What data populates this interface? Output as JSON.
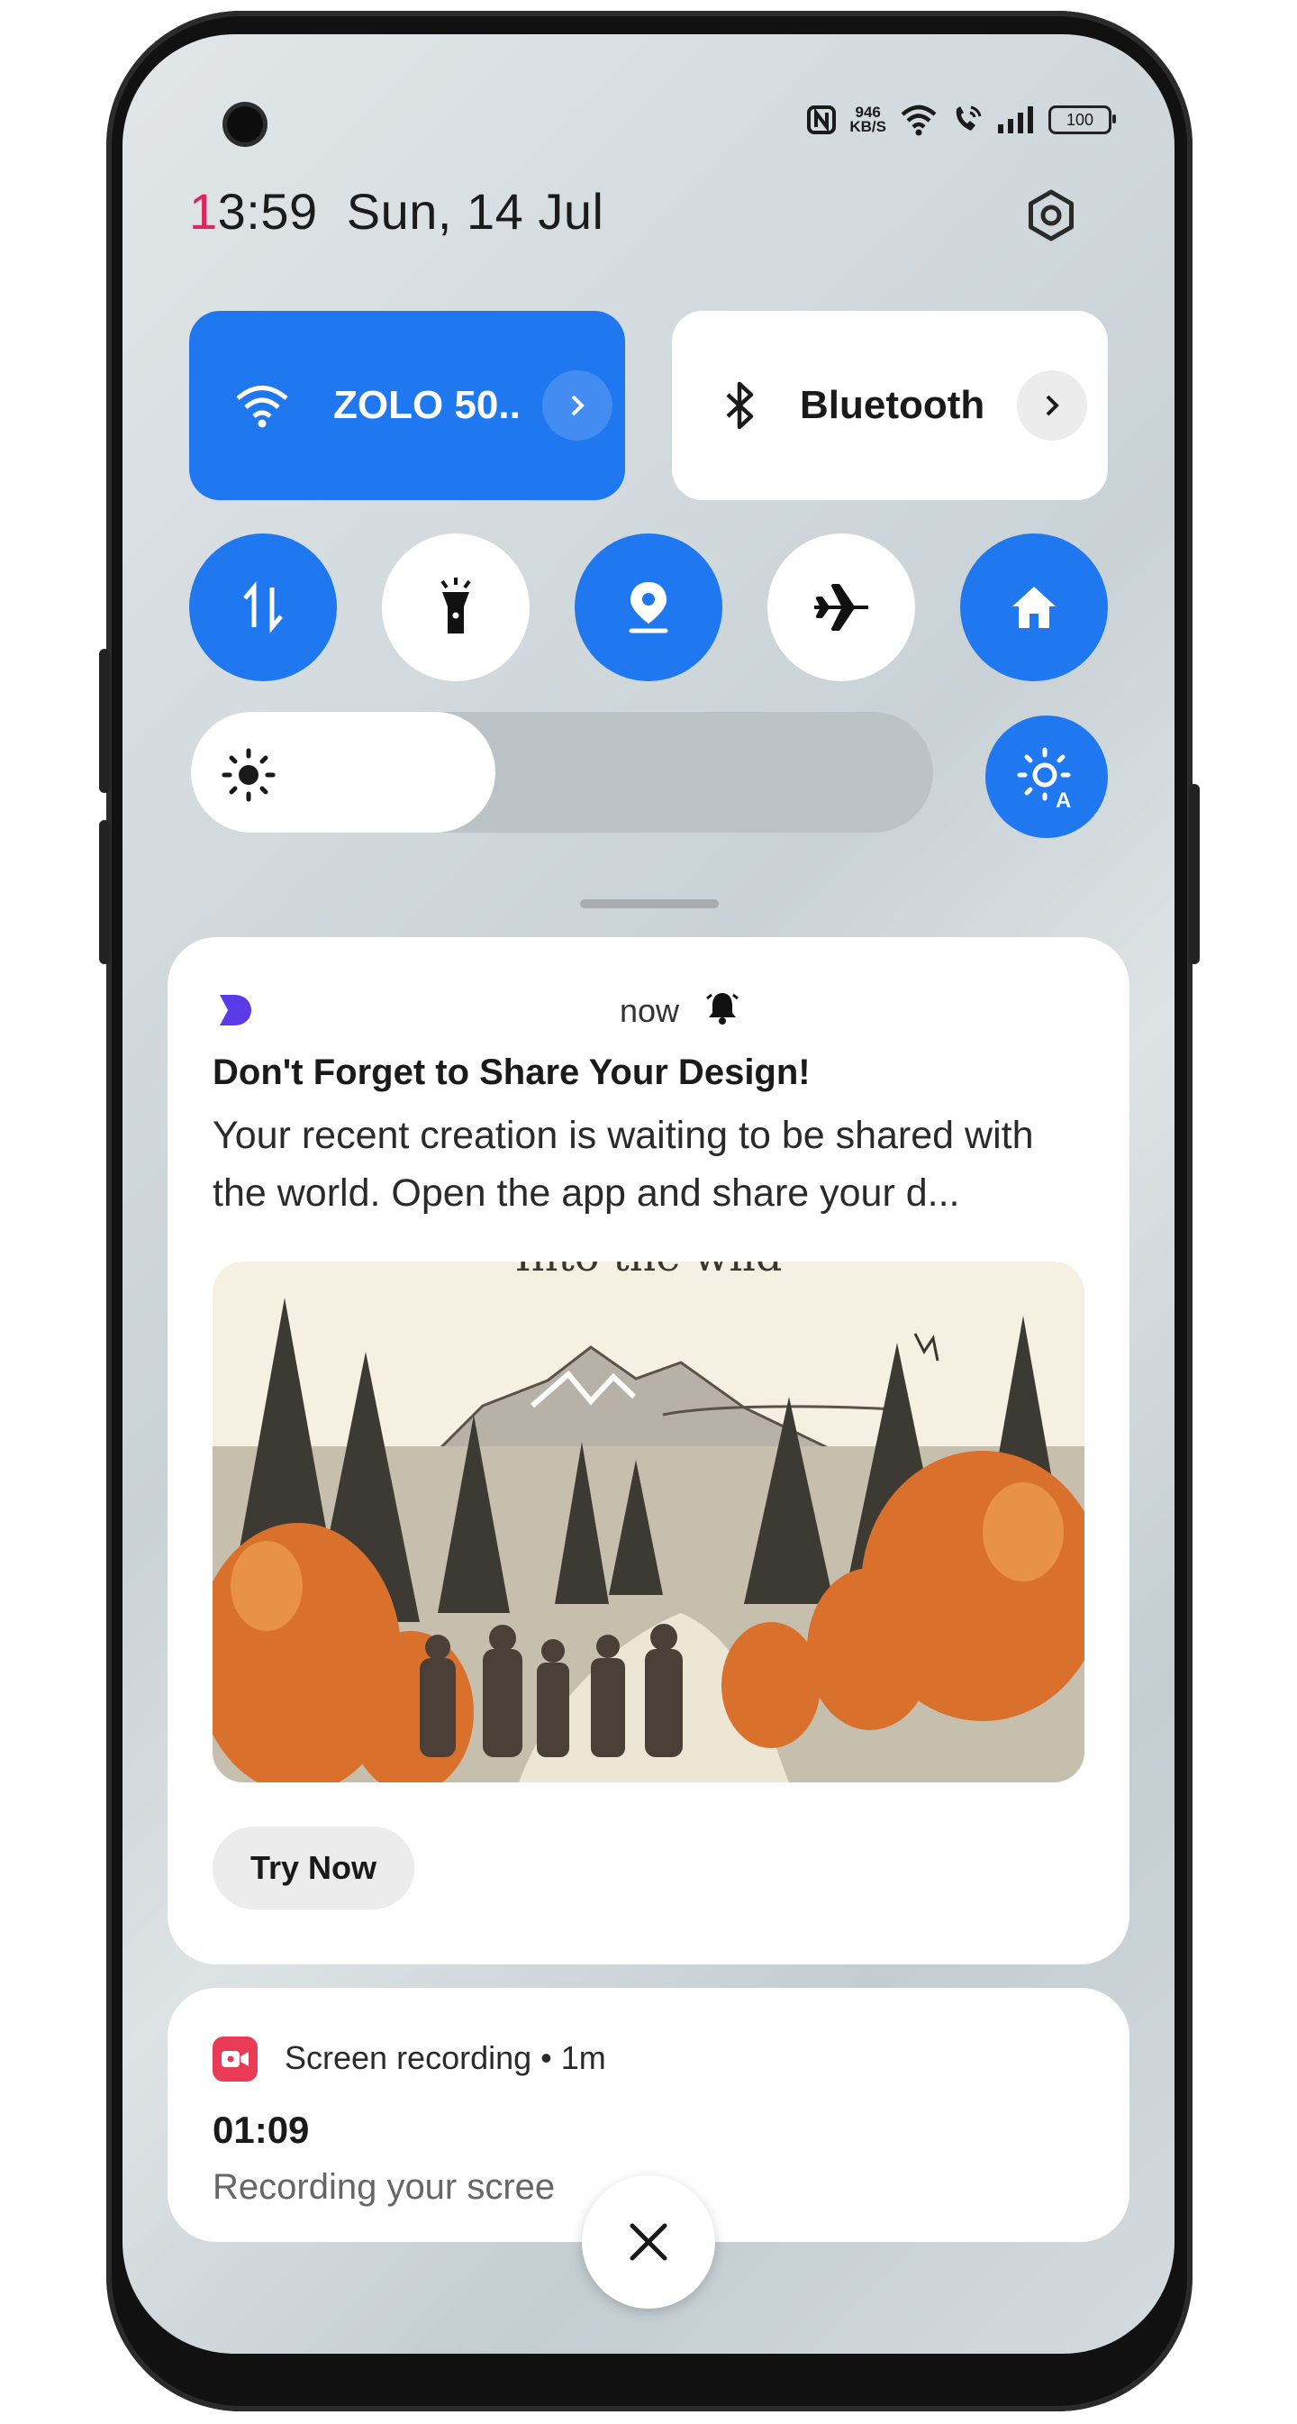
{
  "status_bar": {
    "network_speed_value": "946",
    "network_speed_unit": "KB/S",
    "battery": "100"
  },
  "header": {
    "time_first_digit": "1",
    "time_rest": "3:59",
    "date": "Sun, 14 Jul"
  },
  "quick_settings": {
    "wifi_label": "ZOLO 50..",
    "bluetooth_label": "Bluetooth",
    "toggles": [
      "mobile-data-icon",
      "flashlight-icon",
      "location-icon",
      "airplane-mode-icon",
      "home-icon"
    ],
    "brightness_level": 0.41
  },
  "notifications": {
    "promo": {
      "time": "now",
      "title": "Don't Forget to Share Your Design!",
      "body": "Your recent creation is waiting to be shared with the world. Open the app and share your d...",
      "image_caption": "Into the wild",
      "action_label": "Try Now"
    },
    "recording": {
      "label": "Screen recording • 1m",
      "time": "01:09",
      "description": "Recording your scree"
    }
  },
  "colors": {
    "accent": "#1f78f0",
    "recording_red": "#ea3b56",
    "clock_highlight": "#e0245e",
    "app_icon": "#5b3be8"
  }
}
